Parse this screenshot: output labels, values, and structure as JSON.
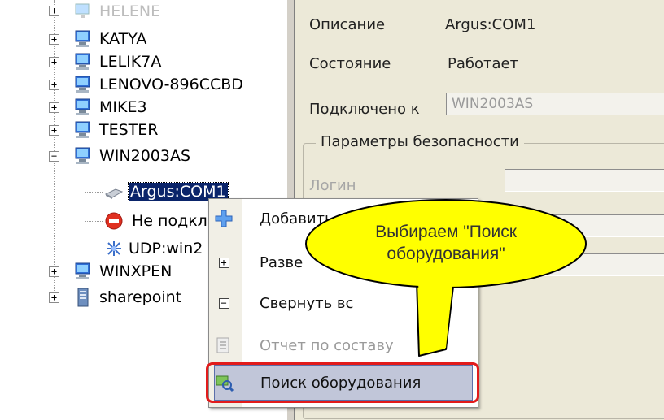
{
  "tree": {
    "nodes": [
      {
        "label": "HELENE"
      },
      {
        "label": "KATYA"
      },
      {
        "label": "LELIK7A"
      },
      {
        "label": "LENOVO-896CCBD"
      },
      {
        "label": "MIKE3"
      },
      {
        "label": "TESTER"
      },
      {
        "label": "WIN2003AS"
      },
      {
        "label": "Argus:COM1"
      },
      {
        "label": "Не подкл"
      },
      {
        "label": "UDP:win2"
      },
      {
        "label": "WINXPEN"
      },
      {
        "label": "sharepoint"
      }
    ],
    "expand_plus": "+",
    "expand_minus": "−"
  },
  "properties": {
    "description_label": "Описание",
    "description_value": "Argus:COM1",
    "state_label": "Состояние",
    "state_value": "Работает",
    "connected_label": "Подключено к",
    "connected_value": "WIN2003AS",
    "security_group": "Параметры безопасности",
    "login_label": "Логин"
  },
  "context_menu": {
    "items": [
      {
        "label": "Добавить",
        "icon": "plus-cross-icon",
        "enabled": true
      },
      {
        "label": "Разве",
        "icon": "expand-box-icon",
        "enabled": true
      },
      {
        "label": "Свернуть вс",
        "icon": "collapse-box-icon",
        "enabled": true
      },
      {
        "label": "Отчет по составу",
        "icon": "report-icon",
        "enabled": false
      },
      {
        "label": "Поиск оборудования",
        "icon": "search-hardware-icon",
        "enabled": true,
        "highlighted": true
      }
    ],
    "box_plus": "+",
    "box_minus": "−"
  },
  "callout": {
    "line1": "Выбираем \"Поиск",
    "line2": "оборудования\""
  },
  "colors": {
    "selection": "#0a246a",
    "highlight_frame": "#e21b1b",
    "callout_fill": "#ffff00",
    "menu_hover": "#c1c6d9"
  }
}
